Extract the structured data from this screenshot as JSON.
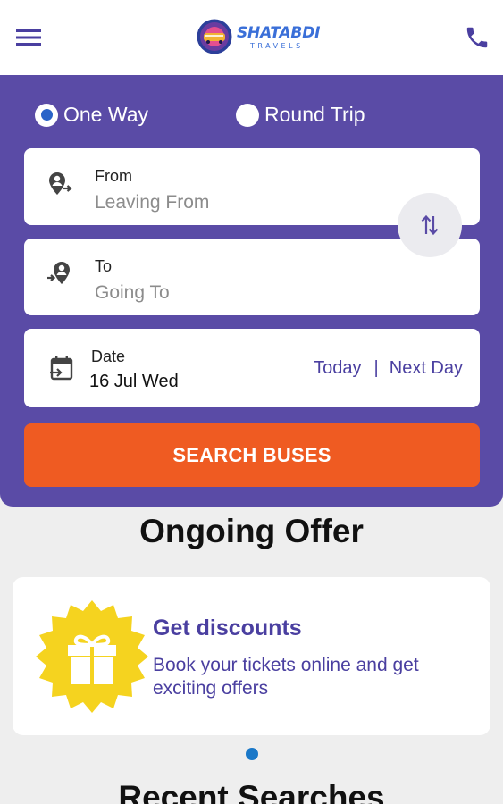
{
  "header": {
    "logo_text": "SHATABDI",
    "logo_sub": "TRAVELS",
    "menu_icon": "hamburger-menu-icon",
    "phone_icon": "phone-icon"
  },
  "trip_type": {
    "one_way": "One Way",
    "round_trip": "Round Trip",
    "selected": "One Way"
  },
  "from": {
    "label": "From",
    "placeholder": "Leaving From",
    "icon": "location-out-icon"
  },
  "to": {
    "label": "To",
    "placeholder": "Going To",
    "icon": "location-in-icon"
  },
  "date": {
    "label": "Date",
    "value": "16 Jul Wed",
    "today": "Today",
    "separator": "|",
    "next_day": "Next Day",
    "icon": "calendar-icon"
  },
  "swap_icon": "swap-vertical-icon",
  "search_button": "SEARCH BUSES",
  "offers": {
    "title": "Ongoing Offer",
    "items": [
      {
        "heading": "Get discounts",
        "description": "Book your tickets online and get exciting offers",
        "icon": "gift-icon"
      }
    ]
  },
  "recent": {
    "title": "Recent Searches"
  },
  "colors": {
    "primary": "#5a4ba6",
    "accent": "#ef5b22",
    "text_primary": "#4a3fa0",
    "badge": "#f5d31f",
    "pager": "#1a78c8"
  }
}
